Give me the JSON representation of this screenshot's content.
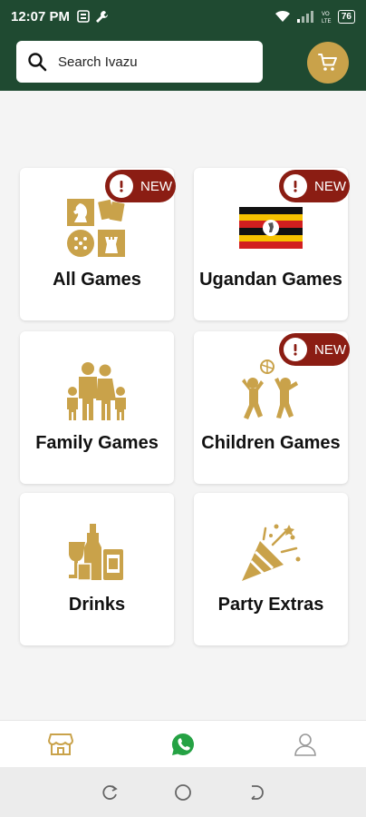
{
  "status_bar": {
    "time": "12:07 PM",
    "battery": "76",
    "network_label": "VoLTE"
  },
  "search": {
    "placeholder": "Search Ivazu"
  },
  "categories": [
    {
      "label": "All Games",
      "icon": "game-pieces-icon",
      "new": true
    },
    {
      "label": "Ugandan Games",
      "icon": "uganda-flag-icon",
      "new": true
    },
    {
      "label": "Family Games",
      "icon": "family-icon",
      "new": false
    },
    {
      "label": "Children Games",
      "icon": "children-playing-icon",
      "new": true
    },
    {
      "label": "Drinks",
      "icon": "drinks-icon",
      "new": false
    },
    {
      "label": "Party Extras",
      "icon": "party-popper-icon",
      "new": false
    }
  ],
  "badge": {
    "label": "NEW"
  },
  "bottom_nav": [
    "store-icon",
    "whatsapp-icon",
    "profile-icon"
  ],
  "colors": {
    "brand_green": "#1f4a31",
    "gold": "#c9a24a",
    "badge_red": "#8b1d13",
    "whatsapp_green": "#25a244"
  }
}
